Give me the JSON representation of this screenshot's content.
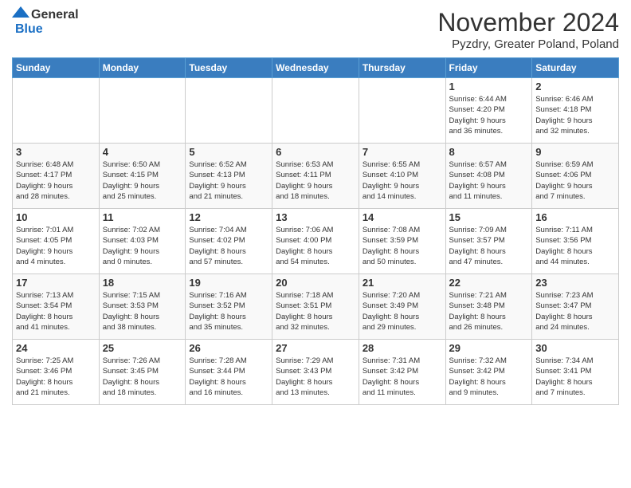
{
  "header": {
    "logo_line1": "General",
    "logo_line2": "Blue",
    "month_title": "November 2024",
    "subtitle": "Pyzdry, Greater Poland, Poland"
  },
  "columns": [
    "Sunday",
    "Monday",
    "Tuesday",
    "Wednesday",
    "Thursday",
    "Friday",
    "Saturday"
  ],
  "weeks": [
    [
      {
        "day": "",
        "info": ""
      },
      {
        "day": "",
        "info": ""
      },
      {
        "day": "",
        "info": ""
      },
      {
        "day": "",
        "info": ""
      },
      {
        "day": "",
        "info": ""
      },
      {
        "day": "1",
        "info": "Sunrise: 6:44 AM\nSunset: 4:20 PM\nDaylight: 9 hours\nand 36 minutes."
      },
      {
        "day": "2",
        "info": "Sunrise: 6:46 AM\nSunset: 4:18 PM\nDaylight: 9 hours\nand 32 minutes."
      }
    ],
    [
      {
        "day": "3",
        "info": "Sunrise: 6:48 AM\nSunset: 4:17 PM\nDaylight: 9 hours\nand 28 minutes."
      },
      {
        "day": "4",
        "info": "Sunrise: 6:50 AM\nSunset: 4:15 PM\nDaylight: 9 hours\nand 25 minutes."
      },
      {
        "day": "5",
        "info": "Sunrise: 6:52 AM\nSunset: 4:13 PM\nDaylight: 9 hours\nand 21 minutes."
      },
      {
        "day": "6",
        "info": "Sunrise: 6:53 AM\nSunset: 4:11 PM\nDaylight: 9 hours\nand 18 minutes."
      },
      {
        "day": "7",
        "info": "Sunrise: 6:55 AM\nSunset: 4:10 PM\nDaylight: 9 hours\nand 14 minutes."
      },
      {
        "day": "8",
        "info": "Sunrise: 6:57 AM\nSunset: 4:08 PM\nDaylight: 9 hours\nand 11 minutes."
      },
      {
        "day": "9",
        "info": "Sunrise: 6:59 AM\nSunset: 4:06 PM\nDaylight: 9 hours\nand 7 minutes."
      }
    ],
    [
      {
        "day": "10",
        "info": "Sunrise: 7:01 AM\nSunset: 4:05 PM\nDaylight: 9 hours\nand 4 minutes."
      },
      {
        "day": "11",
        "info": "Sunrise: 7:02 AM\nSunset: 4:03 PM\nDaylight: 9 hours\nand 0 minutes."
      },
      {
        "day": "12",
        "info": "Sunrise: 7:04 AM\nSunset: 4:02 PM\nDaylight: 8 hours\nand 57 minutes."
      },
      {
        "day": "13",
        "info": "Sunrise: 7:06 AM\nSunset: 4:00 PM\nDaylight: 8 hours\nand 54 minutes."
      },
      {
        "day": "14",
        "info": "Sunrise: 7:08 AM\nSunset: 3:59 PM\nDaylight: 8 hours\nand 50 minutes."
      },
      {
        "day": "15",
        "info": "Sunrise: 7:09 AM\nSunset: 3:57 PM\nDaylight: 8 hours\nand 47 minutes."
      },
      {
        "day": "16",
        "info": "Sunrise: 7:11 AM\nSunset: 3:56 PM\nDaylight: 8 hours\nand 44 minutes."
      }
    ],
    [
      {
        "day": "17",
        "info": "Sunrise: 7:13 AM\nSunset: 3:54 PM\nDaylight: 8 hours\nand 41 minutes."
      },
      {
        "day": "18",
        "info": "Sunrise: 7:15 AM\nSunset: 3:53 PM\nDaylight: 8 hours\nand 38 minutes."
      },
      {
        "day": "19",
        "info": "Sunrise: 7:16 AM\nSunset: 3:52 PM\nDaylight: 8 hours\nand 35 minutes."
      },
      {
        "day": "20",
        "info": "Sunrise: 7:18 AM\nSunset: 3:51 PM\nDaylight: 8 hours\nand 32 minutes."
      },
      {
        "day": "21",
        "info": "Sunrise: 7:20 AM\nSunset: 3:49 PM\nDaylight: 8 hours\nand 29 minutes."
      },
      {
        "day": "22",
        "info": "Sunrise: 7:21 AM\nSunset: 3:48 PM\nDaylight: 8 hours\nand 26 minutes."
      },
      {
        "day": "23",
        "info": "Sunrise: 7:23 AM\nSunset: 3:47 PM\nDaylight: 8 hours\nand 24 minutes."
      }
    ],
    [
      {
        "day": "24",
        "info": "Sunrise: 7:25 AM\nSunset: 3:46 PM\nDaylight: 8 hours\nand 21 minutes."
      },
      {
        "day": "25",
        "info": "Sunrise: 7:26 AM\nSunset: 3:45 PM\nDaylight: 8 hours\nand 18 minutes."
      },
      {
        "day": "26",
        "info": "Sunrise: 7:28 AM\nSunset: 3:44 PM\nDaylight: 8 hours\nand 16 minutes."
      },
      {
        "day": "27",
        "info": "Sunrise: 7:29 AM\nSunset: 3:43 PM\nDaylight: 8 hours\nand 13 minutes."
      },
      {
        "day": "28",
        "info": "Sunrise: 7:31 AM\nSunset: 3:42 PM\nDaylight: 8 hours\nand 11 minutes."
      },
      {
        "day": "29",
        "info": "Sunrise: 7:32 AM\nSunset: 3:42 PM\nDaylight: 8 hours\nand 9 minutes."
      },
      {
        "day": "30",
        "info": "Sunrise: 7:34 AM\nSunset: 3:41 PM\nDaylight: 8 hours\nand 7 minutes."
      }
    ]
  ]
}
